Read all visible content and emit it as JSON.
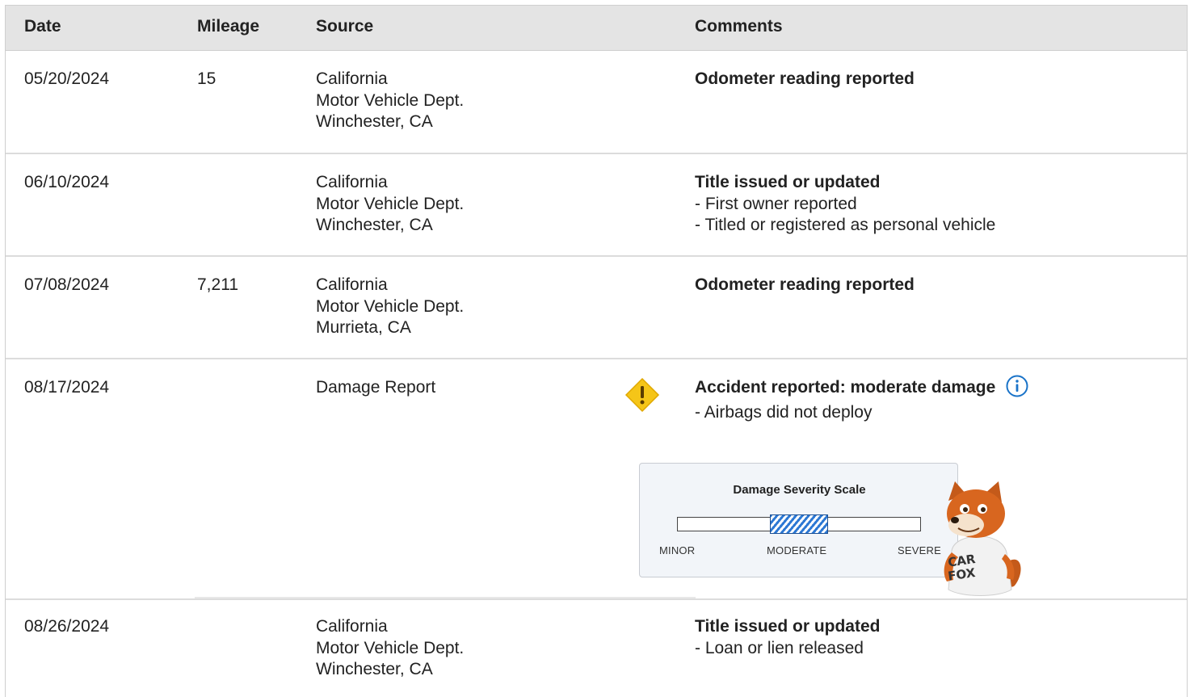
{
  "header": {
    "date": "Date",
    "mileage": "Mileage",
    "source": "Source",
    "comments": "Comments"
  },
  "rows": [
    {
      "date": "05/20/2024",
      "mileage": "15",
      "source": [
        "California",
        "Motor Vehicle Dept.",
        "Winchester, CA"
      ],
      "comment_title": "Odometer reading reported",
      "comment_details": []
    },
    {
      "date": "06/10/2024",
      "mileage": "",
      "source": [
        "California",
        "Motor Vehicle Dept.",
        "Winchester, CA"
      ],
      "comment_title": "Title issued or updated",
      "comment_details": [
        "- First owner reported",
        "- Titled or registered as personal vehicle"
      ]
    },
    {
      "date": "07/08/2024",
      "mileage": "7,211",
      "source": [
        "California",
        "Motor Vehicle Dept.",
        "Murrieta, CA"
      ],
      "comment_title": "Odometer reading reported",
      "comment_details": []
    },
    {
      "date": "08/17/2024",
      "mileage": "",
      "source": [
        "Damage Report"
      ],
      "comment_title": "Accident reported: moderate damage",
      "comment_details": [
        "- Airbags did not deploy"
      ],
      "alert_icon": "warning-diamond-icon",
      "info_icon": "info-circle-icon",
      "severity_scale": {
        "title": "Damage Severity Scale",
        "labels": [
          "MINOR",
          "MODERATE",
          "SEVERE"
        ],
        "highlight_start": 0.38,
        "highlight_end": 0.62
      },
      "mascot": "carfox-mascot",
      "mascot_shirt": "CAR FOX"
    },
    {
      "date": "08/26/2024",
      "mileage": "",
      "source": [
        "California",
        "Motor Vehicle Dept.",
        "Winchester, CA"
      ],
      "comment_title": "Title issued or updated",
      "comment_details": [
        "- Loan or lien released"
      ]
    }
  ],
  "colors": {
    "header_bg": "#e4e4e4",
    "warning": "#f5c518",
    "info": "#1a73c8",
    "severity_fill": "#2c78d4"
  }
}
